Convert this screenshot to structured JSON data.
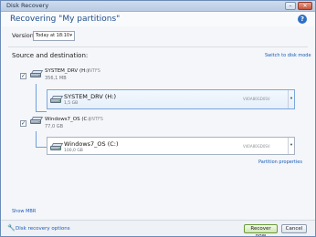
{
  "window": {
    "title": "Disk Recovery",
    "minimize_glyph": "–",
    "close_glyph": "✕"
  },
  "header": {
    "heading": "Recovering \"My partitions\"",
    "help_glyph": "?"
  },
  "version": {
    "label": "Version:",
    "selected": "Today at 18:10",
    "caret": "▾"
  },
  "section": {
    "label": "Source and destination:",
    "switch_link": "Switch to disk mode"
  },
  "sources": [
    {
      "checked": true,
      "name": "SYSTEM_DRV (H:)",
      "fs": "· NTFS",
      "size": "356,1 MB",
      "destination": {
        "name": "SYSTEM_DRV (H:)",
        "size": "1,5 GB",
        "serial": "V40A80GD0SV"
      }
    },
    {
      "checked": true,
      "name": "Windows7_OS (C:)",
      "fs": "· NTFS",
      "size": "77,0 GB",
      "destination": {
        "name": "Windows7_OS (C:)",
        "size": "100,0 GB",
        "serial": "V40A80GD0SV"
      }
    }
  ],
  "check_glyph": "✓",
  "dropdown_glyph": "▾",
  "links": {
    "partition_properties": "Partition properties",
    "show_mbr": "Show MBR"
  },
  "footer": {
    "options_link": "Disk recovery options",
    "recover_button": "Recover now",
    "cancel_button": "Cancel",
    "wrench_glyph": "🔧"
  },
  "colors": {
    "accent": "#1f4e8c",
    "link": "#1a5bb8",
    "tree_line": "#6fa1e0"
  }
}
